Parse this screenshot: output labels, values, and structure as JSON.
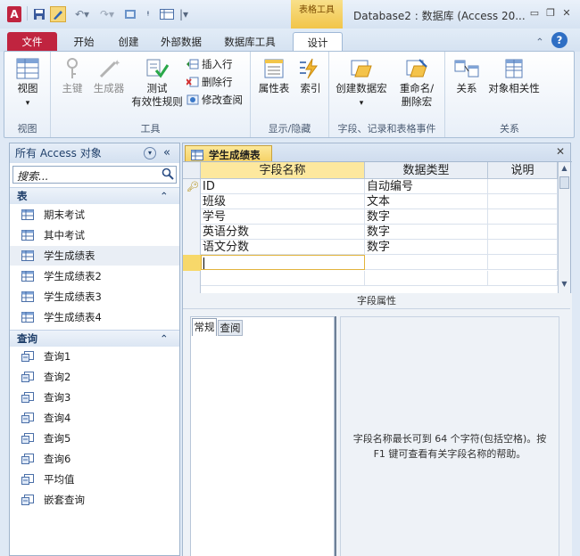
{
  "titlebar": {
    "app_icon": "A",
    "context_tab": "表格工具",
    "title": "Database2 : 数据库 (Access 20...",
    "window_buttons": [
      "minimize-icon",
      "restore-icon",
      "close-icon"
    ]
  },
  "tabs": [
    "文件",
    "开始",
    "创建",
    "外部数据",
    "数据库工具",
    "设计"
  ],
  "ribbon": {
    "views_group": {
      "label": "视图",
      "view_button": "视图"
    },
    "tools_group": {
      "label": "工具",
      "primary_key": "主键",
      "builder": "生成器",
      "test_rules_line1": "测试",
      "test_rules_line2": "有效性规则",
      "insert_rows": "插入行",
      "delete_rows": "删除行",
      "modify_lookups": "修改查阅"
    },
    "show_hide_group": {
      "label": "显示/隐藏",
      "property_sheet": "属性表",
      "indexes": "索引"
    },
    "events_group": {
      "label": "字段、记录和表格事件",
      "create_macros": "创建数据宏",
      "rename_line1": "重命名/",
      "rename_line2": "删除宏"
    },
    "relationships_group": {
      "label": "关系",
      "relationships": "关系",
      "object_dependencies": "对象相关性"
    }
  },
  "nav": {
    "header": "所有 Access 对象",
    "search_placeholder": "搜索...",
    "tables_section": "表",
    "tables": [
      "期末考试",
      "其中考试",
      "学生成绩表",
      "学生成绩表2",
      "学生成绩表3",
      "学生成绩表4"
    ],
    "queries_section": "查询",
    "queries": [
      "查询1",
      "查询2",
      "查询3",
      "查询4",
      "查询5",
      "查询6",
      "平均值",
      "嵌套查询"
    ]
  },
  "document": {
    "tab_title": "学生成绩表",
    "columns": [
      "字段名称",
      "数据类型",
      "说明"
    ],
    "rows": [
      {
        "name": "ID",
        "type": "自动编号"
      },
      {
        "name": "班级",
        "type": "文本"
      },
      {
        "name": "学号",
        "type": "数字"
      },
      {
        "name": "英语分数",
        "type": "数字"
      },
      {
        "name": "语文分数",
        "type": "数字"
      }
    ],
    "field_props_title": "字段属性",
    "prop_tabs": [
      "常规",
      "查阅"
    ],
    "help_text": "字段名称最长可到 64 个字符(包括空格)。按 F1 键可查看有关字段名称的帮助。"
  },
  "colors": {
    "file_tab": "#c0243f",
    "context_tab": "#f2c549",
    "accent": "#1f3f6a"
  }
}
